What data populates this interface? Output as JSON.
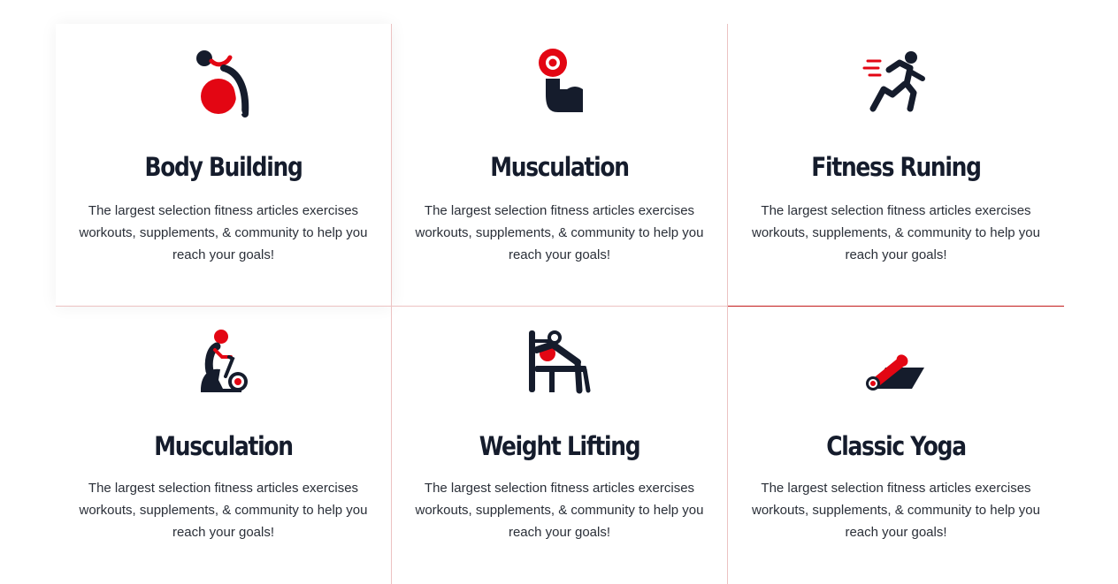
{
  "cards": [
    {
      "icon": "exercise-ball-icon",
      "title": "Body Building",
      "description": "The largest selection fitness articles exercises workouts, supplements, & community to help you reach your goals!"
    },
    {
      "icon": "flexed-arm-dumbbell-icon",
      "title": "Musculation",
      "description": "The largest selection fitness articles exercises workouts, supplements, & community to help you reach your goals!"
    },
    {
      "icon": "runner-icon",
      "title": "Fitness Runing",
      "description": "The largest selection fitness articles exercises workouts, supplements, & community to help you reach your goals!"
    },
    {
      "icon": "exercise-bike-icon",
      "title": "Musculation",
      "description": "The largest selection fitness articles exercises workouts, supplements, & community to help you reach your goals!"
    },
    {
      "icon": "bench-press-icon",
      "title": "Weight Lifting",
      "description": "The largest selection fitness articles exercises workouts, supplements, & community to help you reach your goals!"
    },
    {
      "icon": "yoga-mat-icon",
      "title": "Classic Yoga",
      "description": "The largest selection fitness articles exercises workouts, supplements, & community to help you reach your goals!"
    }
  ],
  "colors": {
    "accent": "#e30613",
    "dark": "#151c2c",
    "divider": "#ecc2c2"
  }
}
